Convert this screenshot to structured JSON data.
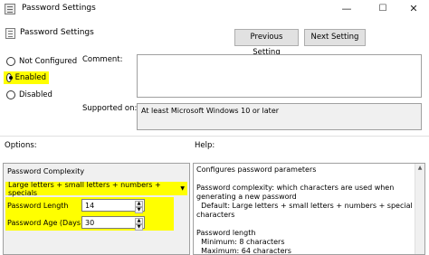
{
  "window": {
    "title": "Password Settings",
    "controls": {
      "minimize": "—",
      "maximize": "☐",
      "close": "✕"
    }
  },
  "header": {
    "setting_name": "Password Settings",
    "prev_button": "Previous Setting",
    "next_button": "Next Setting"
  },
  "state": {
    "options": [
      {
        "label": "Not Configured",
        "selected": false
      },
      {
        "label": "Enabled",
        "selected": true
      },
      {
        "label": "Disabled",
        "selected": false
      }
    ]
  },
  "comment": {
    "label": "Comment:",
    "value": ""
  },
  "supported": {
    "label": "Supported on:",
    "value": "At least Microsoft Windows 10 or later"
  },
  "options_panel": {
    "label": "Options:",
    "group_title": "Password Complexity",
    "complexity_value": "Large letters + small letters + numbers + specials",
    "length_label": "Password Length",
    "length_value": "14",
    "age_label": "Password Age (Days)",
    "age_value": "30"
  },
  "help_panel": {
    "label": "Help:",
    "lines": [
      "Configures password parameters",
      "",
      "Password complexity: which characters are used when",
      "generating a new password",
      "  Default: Large letters + small letters + numbers + special",
      "characters",
      "",
      "Password length",
      "  Minimum: 8 characters",
      "  Maximum: 64 characters"
    ]
  },
  "colors": {
    "highlight": "#ffff00",
    "button_bg": "#e1e1e1",
    "panel_bg": "#f0f0f0"
  }
}
